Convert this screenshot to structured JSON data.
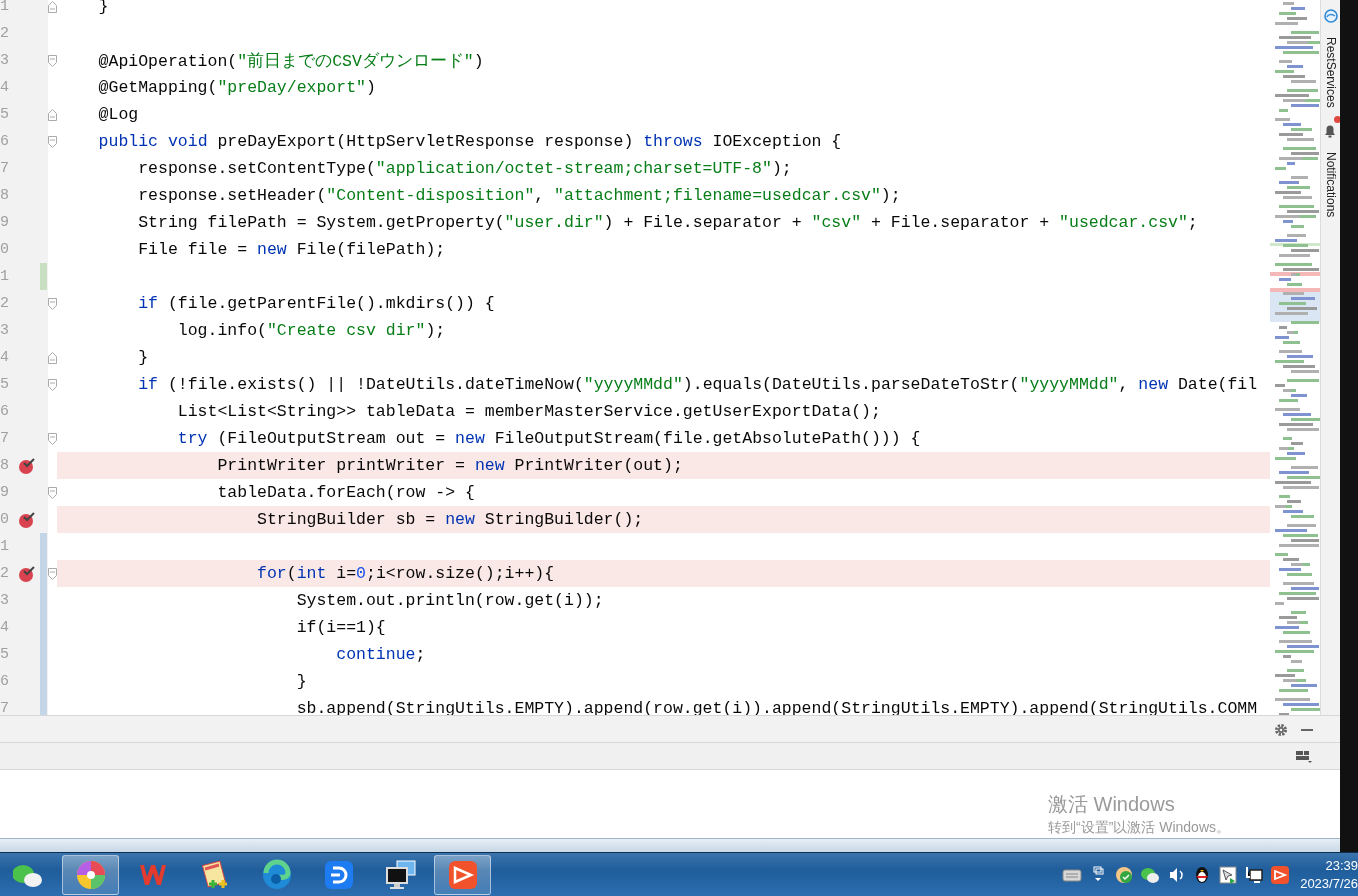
{
  "editor": {
    "lines": [
      {
        "number": "1",
        "fold": {
          "kind": "end"
        },
        "breakpoint": false,
        "tokens": [
          {
            "kind": "text",
            "text": "    }"
          }
        ]
      },
      {
        "number": "2",
        "breakpoint": false
      },
      {
        "number": "3",
        "fold": {
          "kind": "start"
        },
        "breakpoint": false,
        "tokens": [
          {
            "kind": "text",
            "text": "    @ApiOperation("
          },
          {
            "kind": "string",
            "text": "\"前日までのCSVダウンロード\""
          },
          {
            "kind": "text",
            "text": ")"
          }
        ]
      },
      {
        "number": "4",
        "breakpoint": false,
        "tokens": [
          {
            "kind": "text",
            "text": "    @GetMapping("
          },
          {
            "kind": "string",
            "text": "\"preDay/export\""
          },
          {
            "kind": "text",
            "text": ")"
          }
        ]
      },
      {
        "number": "5",
        "fold": {
          "kind": "end"
        },
        "breakpoint": false,
        "tokens": [
          {
            "kind": "text",
            "text": "    @Log"
          }
        ]
      },
      {
        "number": "6",
        "fold": {
          "kind": "start"
        },
        "breakpoint": false,
        "tokens": [
          {
            "kind": "keyword",
            "text": "    public"
          },
          {
            "kind": "keyword",
            "text": " void"
          },
          {
            "kind": "text",
            "text": " preDayExport(HttpServletResponse response) "
          },
          {
            "kind": "keyword",
            "text": "throws"
          },
          {
            "kind": "text",
            "text": " IOException {"
          }
        ]
      },
      {
        "number": "7",
        "breakpoint": false,
        "tokens": [
          {
            "kind": "text",
            "text": "        response.setContentType("
          },
          {
            "kind": "string",
            "text": "\"application/octet-stream;charset=UTF-8\""
          },
          {
            "kind": "text",
            "text": ");"
          }
        ]
      },
      {
        "number": "8",
        "breakpoint": false,
        "tokens": [
          {
            "kind": "text",
            "text": "        response.setHeader("
          },
          {
            "kind": "string",
            "text": "\"Content-disposition\""
          },
          {
            "kind": "text",
            "text": ", "
          },
          {
            "kind": "string",
            "text": "\"attachment;filename=usedcar.csv\""
          },
          {
            "kind": "text",
            "text": ");"
          }
        ]
      },
      {
        "number": "9",
        "breakpoint": false,
        "tokens": [
          {
            "kind": "text",
            "text": "        String filePath = System.getProperty("
          },
          {
            "kind": "string",
            "text": "\"user.dir\""
          },
          {
            "kind": "text",
            "text": ") + File.separator + "
          },
          {
            "kind": "string",
            "text": "\"csv\""
          },
          {
            "kind": "text",
            "text": " + File.separator + "
          },
          {
            "kind": "string",
            "text": "\"usedcar.csv\""
          },
          {
            "kind": "text",
            "text": ";"
          }
        ]
      },
      {
        "number": "0",
        "breakpoint": false,
        "tokens": [
          {
            "kind": "text",
            "text": "        File file = "
          },
          {
            "kind": "keyword",
            "text": "new"
          },
          {
            "kind": "text",
            "text": " File(filePath);"
          }
        ]
      },
      {
        "number": "1",
        "change": {
          "kind": "added"
        },
        "breakpoint": false
      },
      {
        "number": "2",
        "fold": {
          "kind": "start"
        },
        "breakpoint": false,
        "tokens": [
          {
            "kind": "keyword",
            "text": "        if"
          },
          {
            "kind": "text",
            "text": " (file.getParentFile().mkdirs()) {"
          }
        ]
      },
      {
        "number": "3",
        "breakpoint": false,
        "tokens": [
          {
            "kind": "text",
            "text": "            log.info("
          },
          {
            "kind": "string",
            "text": "\"Create csv dir\""
          },
          {
            "kind": "text",
            "text": ");"
          }
        ]
      },
      {
        "number": "4",
        "fold": {
          "kind": "end"
        },
        "breakpoint": false,
        "tokens": [
          {
            "kind": "text",
            "text": "        }"
          }
        ]
      },
      {
        "number": "5",
        "fold": {
          "kind": "start"
        },
        "breakpoint": false,
        "tokens": [
          {
            "kind": "keyword",
            "text": "        if"
          },
          {
            "kind": "text",
            "text": " (!file.exists() || !DateUtils.dateTimeNow("
          },
          {
            "kind": "string",
            "text": "\"yyyyMMdd\""
          },
          {
            "kind": "text",
            "text": ").equals(DateUtils.parseDateToStr("
          },
          {
            "kind": "string",
            "text": "\"yyyyMMdd\""
          },
          {
            "kind": "text",
            "text": ", "
          },
          {
            "kind": "keyword",
            "text": "new"
          },
          {
            "kind": "text",
            "text": " Date(fil"
          }
        ]
      },
      {
        "number": "6",
        "breakpoint": false,
        "tokens": [
          {
            "kind": "text",
            "text": "            List<List<String>> tableData = memberMasterService.getUserExportData();"
          }
        ]
      },
      {
        "number": "7",
        "fold": {
          "kind": "start"
        },
        "breakpoint": false,
        "tokens": [
          {
            "kind": "keyword",
            "text": "            try"
          },
          {
            "kind": "text",
            "text": " (FileOutputStream out = "
          },
          {
            "kind": "keyword",
            "text": "new"
          },
          {
            "kind": "text",
            "text": " FileOutputStream(file.getAbsolutePath())) {"
          }
        ]
      },
      {
        "number": "8",
        "breakpoint": true,
        "tokens": [
          {
            "kind": "text",
            "text": "                PrintWriter printWriter = "
          },
          {
            "kind": "keyword",
            "text": "new"
          },
          {
            "kind": "text",
            "text": " PrintWriter(out);"
          }
        ]
      },
      {
        "number": "9",
        "fold": {
          "kind": "start"
        },
        "breakpoint": false,
        "tokens": [
          {
            "kind": "text",
            "text": "                tableData.forEach(row -> {"
          }
        ]
      },
      {
        "number": "0",
        "breakpoint": true,
        "tokens": [
          {
            "kind": "text",
            "text": "                    StringBuilder sb = "
          },
          {
            "kind": "keyword",
            "text": "new"
          },
          {
            "kind": "text",
            "text": " StringBuilder();"
          }
        ]
      },
      {
        "number": "1",
        "change": {
          "kind": "modified"
        },
        "breakpoint": false
      },
      {
        "number": "2",
        "change": {
          "kind": "modified"
        },
        "fold": {
          "kind": "start"
        },
        "breakpoint": true,
        "tokens": [
          {
            "kind": "keyword",
            "text": "                    for"
          },
          {
            "kind": "text",
            "text": "("
          },
          {
            "kind": "keyword",
            "text": "int"
          },
          {
            "kind": "text",
            "text": " i="
          },
          {
            "kind": "number",
            "text": "0"
          },
          {
            "kind": "text",
            "text": ";i<row.size();i++){"
          }
        ]
      },
      {
        "number": "3",
        "change": {
          "kind": "modified"
        },
        "breakpoint": false,
        "tokens": [
          {
            "kind": "text",
            "text": "                        System.out.println(row.get(i));"
          }
        ]
      },
      {
        "number": "4",
        "change": {
          "kind": "modified"
        },
        "breakpoint": false,
        "tokens": [
          {
            "kind": "text",
            "text": "                        if(i==1){"
          }
        ]
      },
      {
        "number": "5",
        "change": {
          "kind": "modified"
        },
        "breakpoint": false,
        "tokens": [
          {
            "kind": "keyword",
            "text": "                            continue"
          },
          {
            "kind": "text",
            "text": ";"
          }
        ]
      },
      {
        "number": "6",
        "change": {
          "kind": "modified"
        },
        "breakpoint": false,
        "tokens": [
          {
            "kind": "text",
            "text": "                        }"
          }
        ]
      },
      {
        "number": "7",
        "change": {
          "kind": "modified"
        },
        "breakpoint": false,
        "tokens": [
          {
            "kind": "text",
            "text": "                        sb.append(StringUtils.EMPTY).append(row.get(i)).append(StringUtils.EMPTY).append(StringUtils.COMM"
          }
        ]
      }
    ]
  },
  "tool_windows": [
    {
      "label": "RestServices",
      "unread": false
    },
    {
      "label": "Notifications",
      "unread": true
    }
  ],
  "activation": {
    "title": "激活 Windows",
    "hint": "转到“设置”以激活 Windows。"
  },
  "taskbar": {
    "apps": [
      {
        "active": false
      },
      {
        "active": true
      },
      {
        "active": false
      },
      {
        "active": false
      },
      {
        "active": false
      },
      {
        "active": false
      },
      {
        "active": false
      },
      {
        "active": true
      }
    ],
    "clock": {
      "time": "23:39",
      "date": "2023/7/26"
    }
  }
}
